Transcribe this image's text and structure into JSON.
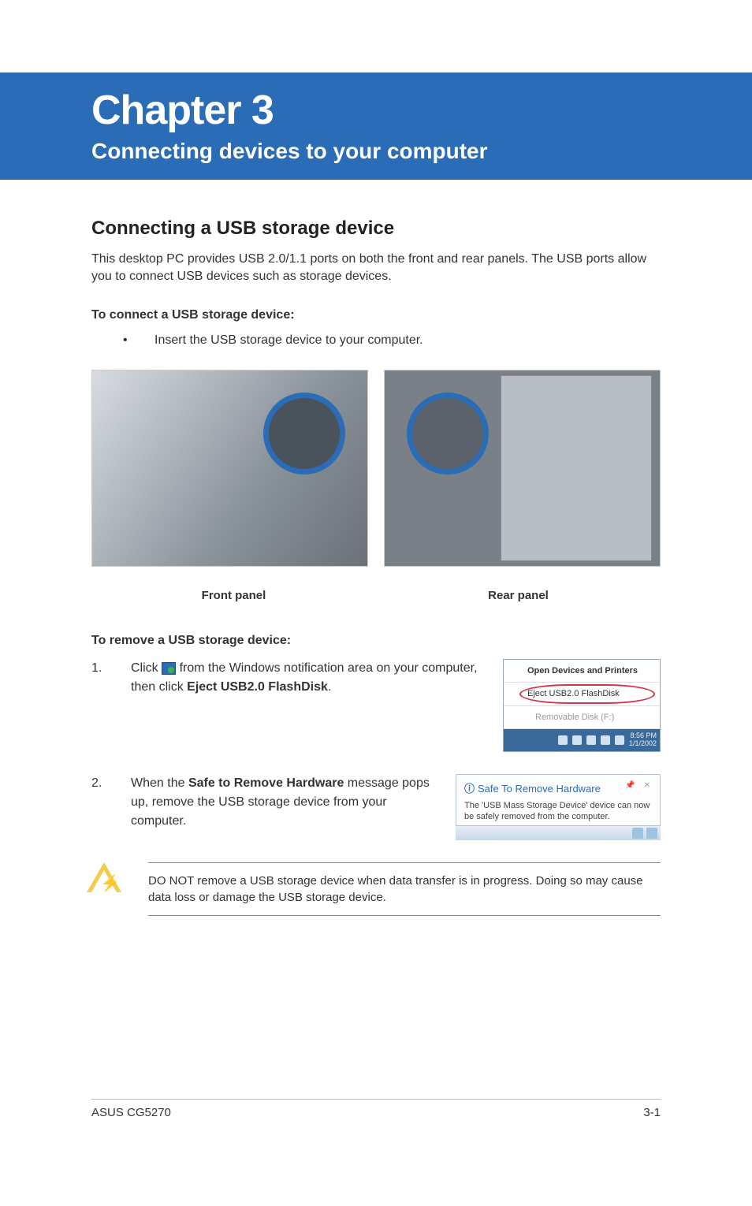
{
  "chapter": {
    "title": "Chapter 3",
    "subtitle": "Connecting devices to your computer"
  },
  "section_heading": "Connecting a USB storage device",
  "intro_text": "This desktop PC provides USB 2.0/1.1 ports on both the front and rear panels. The USB ports allow you to connect USB devices such as storage devices.",
  "connect_heading": "To connect a USB storage device:",
  "connect_bullet": "Insert the USB storage device to your computer.",
  "figure_captions": {
    "front": "Front panel",
    "rear": "Rear panel"
  },
  "remove_heading": "To remove a USB storage device:",
  "steps": {
    "1": {
      "num": "1.",
      "pre": "Click ",
      "mid": " from the Windows notification area on your computer, then click ",
      "bold": "Eject USB2.0 FlashDisk",
      "post": "."
    },
    "2": {
      "num": "2.",
      "pre": "When the ",
      "bold": "Safe to Remove Hardware",
      "post": " message pops up, remove the USB storage device from your computer."
    }
  },
  "eject_menu": {
    "open_devices": "Open Devices and Printers",
    "eject_label": "Eject USB2.0 FlashDisk",
    "removable": "Removable Disk (F:)",
    "time": "8:56 PM",
    "date": "1/1/2002"
  },
  "safe_popup": {
    "title": "Safe To Remove Hardware",
    "text": "The 'USB Mass Storage Device' device can now be safely removed from the computer."
  },
  "warning_text": "DO NOT remove a USB storage device when data transfer is in progress. Doing so may cause data loss or damage the USB storage device.",
  "footer": {
    "left": "ASUS CG5270",
    "right": "3-1"
  }
}
